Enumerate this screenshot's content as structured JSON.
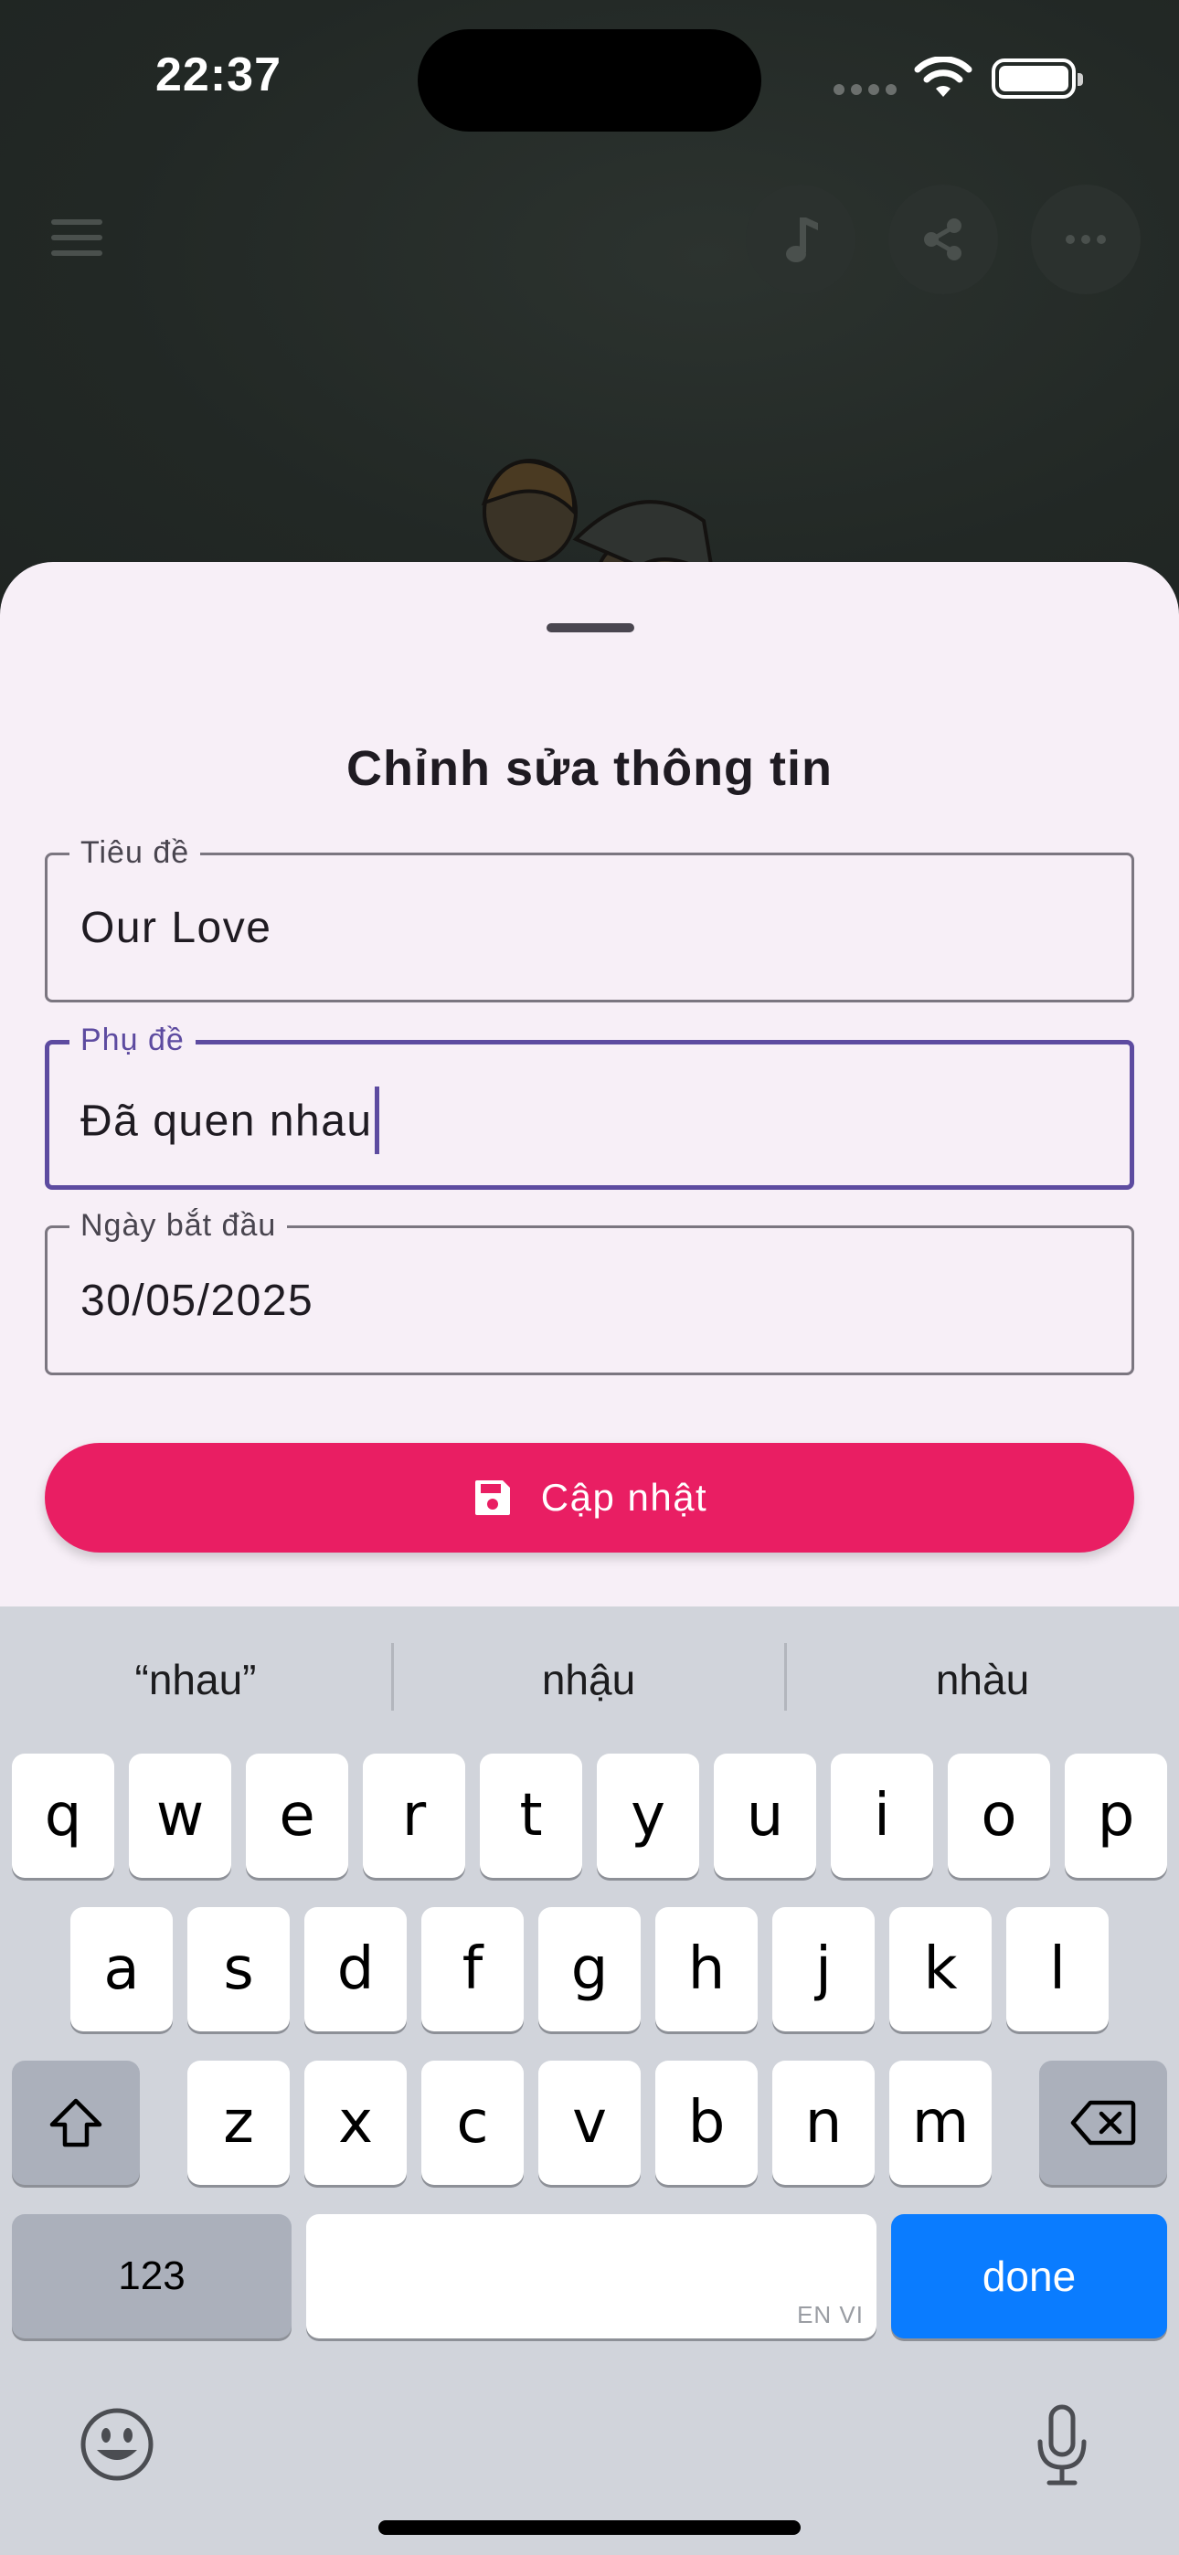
{
  "status_bar": {
    "time": "22:37"
  },
  "header": {
    "menu_icon": "hamburger-menu-icon",
    "actions": [
      "music-note-icon",
      "share-icon",
      "more-horizontal-icon"
    ]
  },
  "sheet": {
    "title": "Chỉnh sửa thông tin",
    "fields": {
      "title": {
        "label": "Tiêu đề",
        "value": "Our Love"
      },
      "subtitle": {
        "label": "Phụ đề",
        "value": "Đã quen nhau"
      },
      "start_date": {
        "label": "Ngày bắt đầu",
        "value": "30/05/2025"
      }
    },
    "update_button": {
      "label": "Cập nhật",
      "icon": "save-icon"
    }
  },
  "keyboard": {
    "suggestions": [
      "“nhau”",
      "nhậu",
      "nhàu"
    ],
    "row1": [
      "q",
      "w",
      "e",
      "r",
      "t",
      "y",
      "u",
      "i",
      "o",
      "p"
    ],
    "row2": [
      "a",
      "s",
      "d",
      "f",
      "g",
      "h",
      "j",
      "k",
      "l"
    ],
    "row3": [
      "z",
      "x",
      "c",
      "v",
      "b",
      "n",
      "m"
    ],
    "numbers_label": "123",
    "space_hint": "EN VI",
    "done_label": "done"
  },
  "colors": {
    "accent": "#e91e63",
    "focus": "#5d4ba0",
    "sheet_bg": "#f7eff7",
    "keyboard_done": "#0a7cff"
  }
}
